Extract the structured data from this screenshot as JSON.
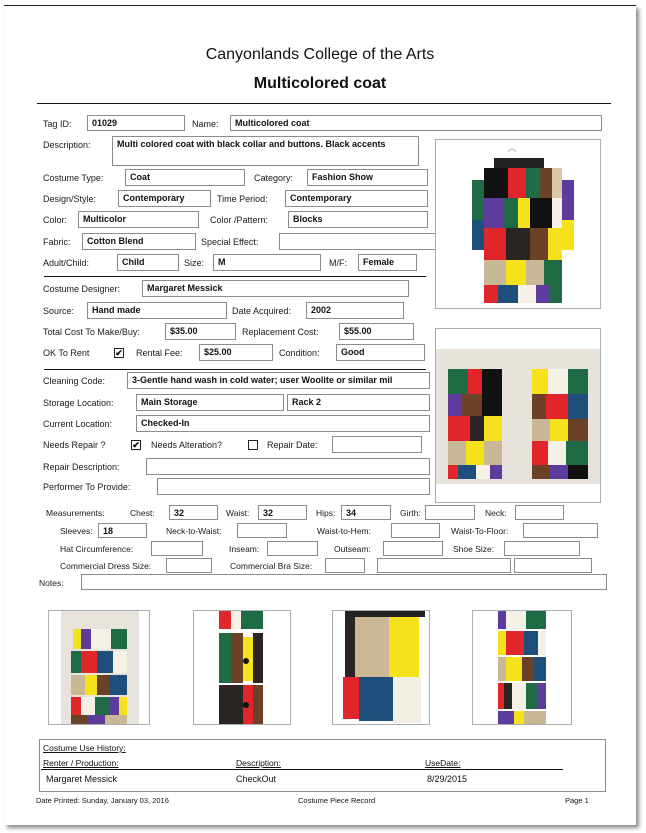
{
  "header": {
    "institution": "Canyonlands College of the Arts",
    "record_title": "Multicolored coat"
  },
  "fields": {
    "tag_id": {
      "label": "Tag ID:",
      "value": "01029"
    },
    "name": {
      "label": "Name:",
      "value": "Multicolored coat"
    },
    "description": {
      "label": "Description:",
      "value": "Multi colored coat with black collar and buttons.  Black accents"
    },
    "costume_type": {
      "label": "Costume Type:",
      "value": "Coat"
    },
    "category": {
      "label": "Category:",
      "value": "Fashion Show"
    },
    "design_style": {
      "label": "Design/Style:",
      "value": "Contemporary"
    },
    "time_period": {
      "label": "Time Period:",
      "value": "Contemporary"
    },
    "color": {
      "label": "Color:",
      "value": "Multicolor"
    },
    "color_pattern": {
      "label": "Color /Pattern:",
      "value": "Blocks"
    },
    "fabric": {
      "label": "Fabric:",
      "value": "Cotton Blend"
    },
    "special_effect": {
      "label": "Special Effect:",
      "value": ""
    },
    "adult_child": {
      "label": "Adult/Child:",
      "value": "Child"
    },
    "size": {
      "label": "Size:",
      "value": "M"
    },
    "mf": {
      "label": "M/F:",
      "value": "Female"
    },
    "costume_designer": {
      "label": "Costume Designer:",
      "value": "Margaret Messick"
    },
    "source": {
      "label": "Source:",
      "value": "Hand made"
    },
    "date_acquired": {
      "label": "Date Acquired:",
      "value": "2002"
    },
    "total_cost": {
      "label": "Total Cost To Make/Buy:",
      "value": "$35.00"
    },
    "replacement_cost": {
      "label": "Replacement Cost:",
      "value": "$55.00"
    },
    "ok_to_rent": {
      "label": "OK To Rent",
      "checked": true,
      "mark": "✔"
    },
    "rental_fee": {
      "label": "Rental Fee:",
      "value": "$25.00"
    },
    "condition": {
      "label": "Condition:",
      "value": "Good"
    },
    "cleaning_code": {
      "label": "Cleaning Code:",
      "value": "3-Gentle hand wash in cold water; user Woolite or similar mil"
    },
    "storage_location": {
      "label": "Storage Location:",
      "value": "Main Storage",
      "value2": "Rack 2"
    },
    "current_location": {
      "label": "Current Location:",
      "value": "Checked-In"
    },
    "needs_repair": {
      "label": "Needs Repair ?",
      "checked": true,
      "mark": "✔"
    },
    "needs_alteration": {
      "label": "Needs Alteration?",
      "checked": false,
      "mark": ""
    },
    "repair_date": {
      "label": "Repair Date:",
      "value": ""
    },
    "repair_description": {
      "label": "Repair Description:",
      "value": ""
    },
    "performer_to_provide": {
      "label": "Performer To Provide:",
      "value": ""
    }
  },
  "measurements": {
    "title": "Measurements:",
    "chest": {
      "label": "Chest:",
      "value": "32"
    },
    "waist": {
      "label": "Waist:",
      "value": "32"
    },
    "hips": {
      "label": "Hips:",
      "value": "34"
    },
    "girth": {
      "label": "Girth:",
      "value": ""
    },
    "neck": {
      "label": "Neck:",
      "value": ""
    },
    "sleeves": {
      "label": "Sleeves:",
      "value": "18"
    },
    "neck_to_waist": {
      "label": "Neck-to-Waist:",
      "value": ""
    },
    "waist_to_hem": {
      "label": "Waist-to-Hem:",
      "value": ""
    },
    "waist_to_floor": {
      "label": "Waist-To-Floor:",
      "value": ""
    },
    "hat_circumference": {
      "label": "Hat Circumference:",
      "value": ""
    },
    "inseam": {
      "label": "Inseam:",
      "value": ""
    },
    "outseam": {
      "label": "Outseam:",
      "value": ""
    },
    "shoe_size": {
      "label": "Shoe Size:",
      "value": ""
    },
    "commercial_dress_size": {
      "label": "Commercial Dress Size:",
      "value": ""
    },
    "commercial_bra_size": {
      "label": "Commercial Bra Size:",
      "value": ""
    },
    "notes": {
      "label": "Notes:",
      "value": ""
    }
  },
  "photos": {
    "main": "coat-front-photo",
    "pair": "coat-front-and-back-photo",
    "thumbs": [
      "coat-back-photo",
      "coat-button-placket-detail",
      "coat-hem-detail",
      "coat-sleeve-detail"
    ]
  },
  "history": {
    "title": "Costume Use History:",
    "columns": [
      "Renter / Production:",
      "Description:",
      "UseDate:"
    ],
    "rows": [
      [
        "Margaret Messick",
        "CheckOut",
        "8/29/2015"
      ]
    ]
  },
  "footer": {
    "date_printed": "Date Printed: Sunday, January 03, 2016",
    "report_name": "Costume Piece Record",
    "page": "Page 1"
  }
}
